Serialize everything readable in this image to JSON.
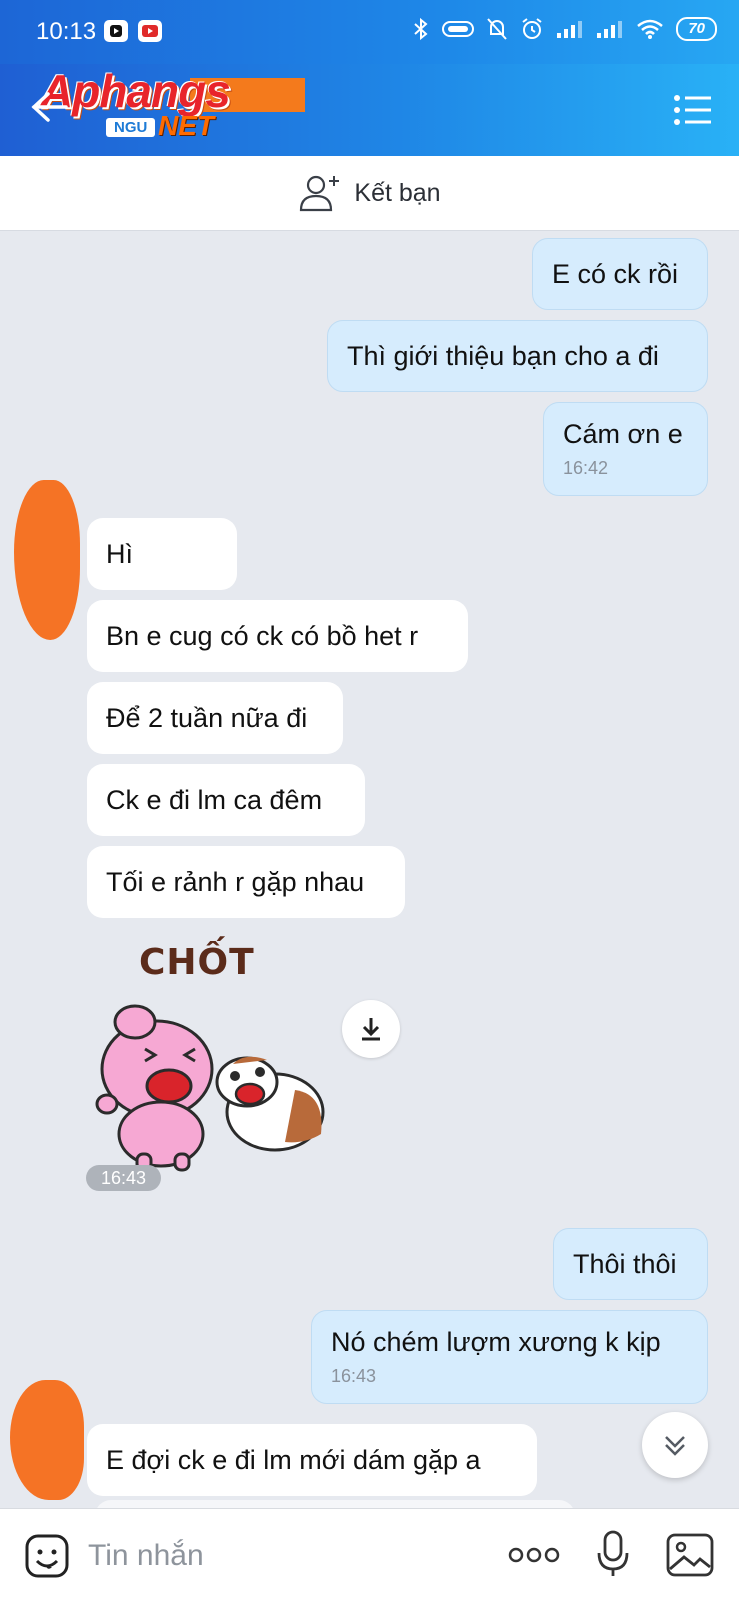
{
  "status_bar": {
    "time": "10:13",
    "battery": "70"
  },
  "header": {
    "watermark": {
      "brand": "Aphangs",
      "sub": "NGU",
      "suffix": "NET"
    }
  },
  "add_friend": {
    "label": "Kết bạn"
  },
  "messages": [
    {
      "direction": "out",
      "text": "E có ck rồi"
    },
    {
      "direction": "out",
      "text": "Thì giới thiệu bạn cho a đi"
    },
    {
      "direction": "out",
      "text": "Cám ơn e",
      "time": "16:42"
    },
    {
      "direction": "in",
      "text": "Hì"
    },
    {
      "direction": "in",
      "text": "Bn e cug có ck có bồ het r"
    },
    {
      "direction": "in",
      "text": "Để 2 tuần nữa đi"
    },
    {
      "direction": "in",
      "text": "Ck e đi lm ca đêm"
    },
    {
      "direction": "in",
      "text": "Tối e rảnh r gặp nhau"
    },
    {
      "direction": "in",
      "type": "sticker",
      "caption": "CHỐT",
      "time": "16:43"
    },
    {
      "direction": "out",
      "text": "Thôi thôi"
    },
    {
      "direction": "out",
      "text": "Nó chém lượm xương k kịp",
      "time": "16:43"
    },
    {
      "direction": "in",
      "text": "E đợi ck e đi lm mới dám gặp a"
    }
  ],
  "composer": {
    "placeholder": "Tin nhắn"
  },
  "colors": {
    "header_start": "#1f5fd3",
    "header_end": "#29b1f6",
    "outgoing_bubble": "#d6ecfd",
    "incoming_bubble": "#ffffff",
    "chat_background": "#e6e9ef",
    "redaction": "#f57325"
  },
  "icons": [
    "back-arrow-icon",
    "menu-list-icon",
    "add-friend-icon",
    "download-icon",
    "scroll-down-icon",
    "sticker-icon",
    "more-icon",
    "microphone-icon",
    "image-icon"
  ]
}
